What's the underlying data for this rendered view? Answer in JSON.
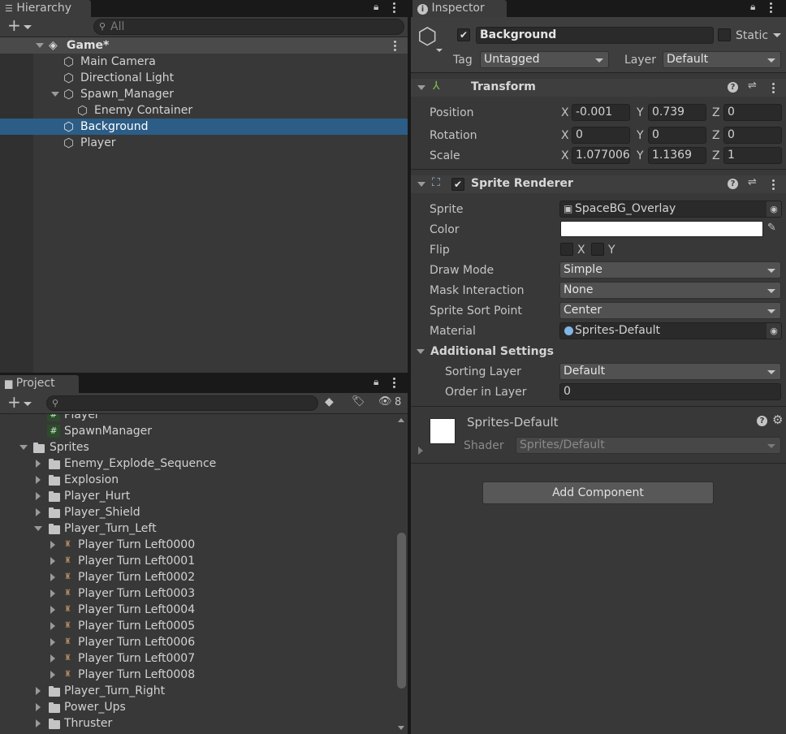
{
  "hierarchy": {
    "tab_label": "Hierarchy",
    "search_placeholder": "All",
    "scene": "Game*",
    "items": [
      {
        "label": "Main Camera"
      },
      {
        "label": "Directional Light"
      },
      {
        "label": "Spawn_Manager"
      },
      {
        "label": "Enemy Container"
      },
      {
        "label": "Background"
      },
      {
        "label": "Player"
      }
    ]
  },
  "project": {
    "tab_label": "Project",
    "hidden_count": "8",
    "items": [
      {
        "label": "Player"
      },
      {
        "label": "SpawnManager"
      },
      {
        "label": "Sprites"
      },
      {
        "label": "Enemy_Explode_Sequence"
      },
      {
        "label": "Explosion"
      },
      {
        "label": "Player_Hurt"
      },
      {
        "label": "Player_Shield"
      },
      {
        "label": "Player_Turn_Left"
      },
      {
        "label": "Player Turn Left0000"
      },
      {
        "label": "Player Turn Left0001"
      },
      {
        "label": "Player Turn Left0002"
      },
      {
        "label": "Player Turn Left0003"
      },
      {
        "label": "Player Turn Left0004"
      },
      {
        "label": "Player Turn Left0005"
      },
      {
        "label": "Player Turn Left0006"
      },
      {
        "label": "Player Turn Left0007"
      },
      {
        "label": "Player Turn Left0008"
      },
      {
        "label": "Player_Turn_Right"
      },
      {
        "label": "Power_Ups"
      },
      {
        "label": "Thruster"
      }
    ]
  },
  "inspector": {
    "tab_label": "Inspector",
    "object_name": "Background",
    "static_label": "Static",
    "tag_label": "Tag",
    "tag_value": "Untagged",
    "layer_label": "Layer",
    "layer_value": "Default",
    "transform": {
      "title": "Transform",
      "position_label": "Position",
      "rotation_label": "Rotation",
      "scale_label": "Scale",
      "x": "X",
      "y": "Y",
      "z": "Z",
      "position": {
        "x": "-0.001",
        "y": "0.739",
        "z": "0"
      },
      "rotation": {
        "x": "0",
        "y": "0",
        "z": "0"
      },
      "scale": {
        "x": "1.077006",
        "y": "1.1369",
        "z": "1"
      }
    },
    "sprite_renderer": {
      "title": "Sprite Renderer",
      "sprite_label": "Sprite",
      "sprite_value": "SpaceBG_Overlay",
      "color_label": "Color",
      "color_value": "#ffffff",
      "flip_label": "Flip",
      "flip_x": "X",
      "flip_y": "Y",
      "draw_mode_label": "Draw Mode",
      "draw_mode_value": "Simple",
      "mask_label": "Mask Interaction",
      "mask_value": "None",
      "sort_point_label": "Sprite Sort Point",
      "sort_point_value": "Center",
      "material_label": "Material",
      "material_value": "Sprites-Default",
      "additional_settings": "Additional Settings",
      "sorting_layer_label": "Sorting Layer",
      "sorting_layer_value": "Default",
      "order_label": "Order in Layer",
      "order_value": "0"
    },
    "material": {
      "name": "Sprites-Default",
      "shader_label": "Shader",
      "shader_value": "Sprites/Default"
    },
    "add_component": "Add Component"
  },
  "colors": {
    "selection": "#2c5d87",
    "panel": "#383838",
    "header": "#3e3e3e"
  }
}
